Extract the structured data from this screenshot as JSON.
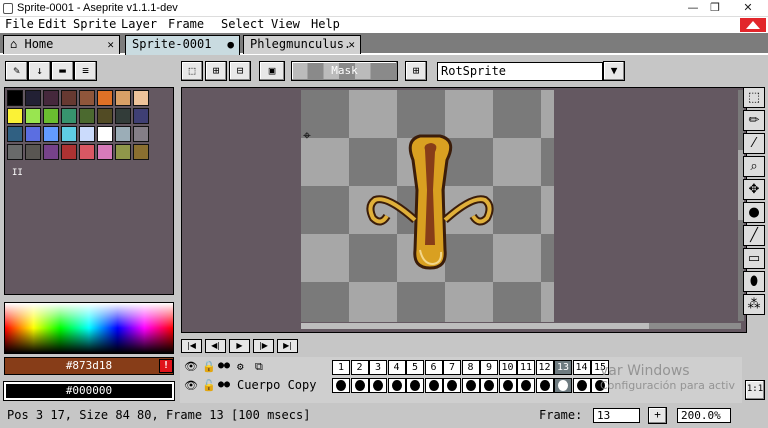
{
  "window": {
    "title": "Sprite-0001 - Aseprite v1.1.1-dev",
    "minimize": "—",
    "restore": "❐",
    "close": "✕"
  },
  "menu": [
    "File",
    "Edit",
    "Sprite",
    "Layer",
    "Frame",
    "Select",
    "View",
    "Help"
  ],
  "tabs": [
    {
      "label": "Home",
      "icon": "home-icon",
      "close": "✕"
    },
    {
      "label": "Sprite-0001",
      "close": "●"
    },
    {
      "label": "Phlegmunculus.",
      "close": "✕"
    }
  ],
  "toolbar": {
    "mask_label": "Mask",
    "rotation_algorithm": "RotSprite"
  },
  "colors": {
    "foreground_label": "#873d18",
    "background_label": "#000000",
    "foreground": "#873d18",
    "background": "#000000",
    "warning": "!",
    "palette": [
      "#000000",
      "#222034",
      "#45283c",
      "#663931",
      "#8f563b",
      "#df7126",
      "#d9a066",
      "#eec39a",
      "#fbf236",
      "#99e550",
      "#6abe30",
      "#37946e",
      "#4b692f",
      "#524b24",
      "#323c39",
      "#3f3f74",
      "#306082",
      "#5b6ee1",
      "#639bff",
      "#5fcde4",
      "#cbdbfc",
      "#ffffff",
      "#9badb7",
      "#847e87",
      "#696a6a",
      "#595652",
      "#76428a",
      "#ac3232",
      "#d95763",
      "#d77bba",
      "#8f974a",
      "#8a6f30"
    ],
    "palette_more": "II"
  },
  "timeline": {
    "frames": [
      "1",
      "2",
      "3",
      "4",
      "5",
      "6",
      "7",
      "8",
      "9",
      "10",
      "11",
      "12",
      "13",
      "14",
      "15"
    ],
    "selected_frame_index": 12,
    "layer_name": "Cuerpo Copy",
    "zoom_button": "1:1"
  },
  "watermark": {
    "line1": "var Windows",
    "line2": "Configuración para activ"
  },
  "status": {
    "text": "Pos 3 17, Size 84 80, Frame 13 [100 msecs]",
    "frame_label": "Frame:",
    "frame_value": "13",
    "add": "+",
    "zoom": "200.0%"
  }
}
